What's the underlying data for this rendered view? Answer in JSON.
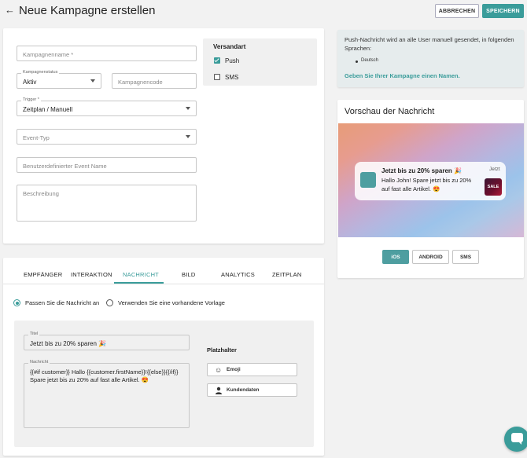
{
  "header": {
    "title": "Neue Kampagne erstellen",
    "cancel_label": "ABBRECHEN",
    "save_label": "SPEICHERN"
  },
  "form": {
    "name_placeholder": "Kampagnenname *",
    "status_label": "Kampagnenstatus",
    "status_value": "Aktiv",
    "code_placeholder": "Kampagnencode",
    "trigger_label": "Trigger *",
    "trigger_value": "Zeitplan / Manuell",
    "event_type_placeholder": "Event-Typ",
    "custom_event_placeholder": "Benutzerdefinierter Event Name",
    "description_placeholder": "Beschreibung"
  },
  "versandart": {
    "title": "Versandart",
    "push_label": "Push",
    "sms_label": "SMS"
  },
  "info": {
    "text": "Push-Nachricht wird an alle User manuell gesendet, in folgenden Sprachen:",
    "language": "Deutsch",
    "link": "Geben Sie Ihrer Kampagne einen Namen."
  },
  "preview": {
    "title": "Vorschau der Nachricht",
    "notif_title": "Jetzt bis zu 20% sparen 🎉",
    "notif_body": "Hallo John! Spare jetzt bis zu 20% auf fast alle Artikel. 😍",
    "notif_time": "Jetzt",
    "sale_label": "SALE",
    "os_ios": "iOS",
    "os_android": "ANDROID",
    "os_sms": "SMS"
  },
  "tabs": [
    "EMPFÄNGER",
    "INTERAKTION",
    "NACHRICHT",
    "BILD",
    "ANALYTICS",
    "ZEITPLAN"
  ],
  "message": {
    "option_custom": "Passen Sie die Nachricht an",
    "option_template": "Verwenden Sie eine vorhandene Vorlage",
    "title_label": "Titel",
    "title_value": "Jetzt bis zu 20% sparen 🎉",
    "body_label": "Nachricht",
    "body_line1": "{{#if customer}} Hallo {{customer.firstName}}!{{else}}{{/if}}",
    "body_line2": "Spare jetzt bis zu 20% auf fast alle Artikel. 😍",
    "placeholder_title": "Platzhalter",
    "emoji_label": "Emoji",
    "kunden_label": "Kundendaten"
  },
  "colors": {
    "accent": "#3a9c9a"
  }
}
